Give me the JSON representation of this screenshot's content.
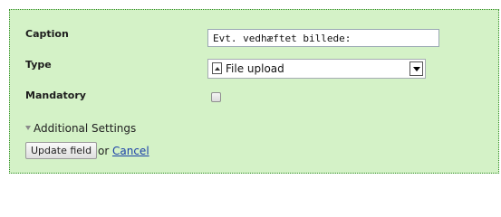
{
  "form": {
    "caption": {
      "label": "Caption",
      "value": "Evt. vedhæftet billede:"
    },
    "type": {
      "label": "Type",
      "selected": "File upload",
      "icon": "file-upload-icon"
    },
    "mandatory": {
      "label": "Mandatory",
      "checked": false
    },
    "additional_settings": {
      "label": "Additional Settings",
      "expanded": false
    },
    "actions": {
      "update_label": "Update field",
      "or_text": "or",
      "cancel_label": "Cancel"
    }
  },
  "colors": {
    "panel_background": "#d4f2c7",
    "panel_border": "#2e8b22",
    "link": "#1a3fa8"
  }
}
